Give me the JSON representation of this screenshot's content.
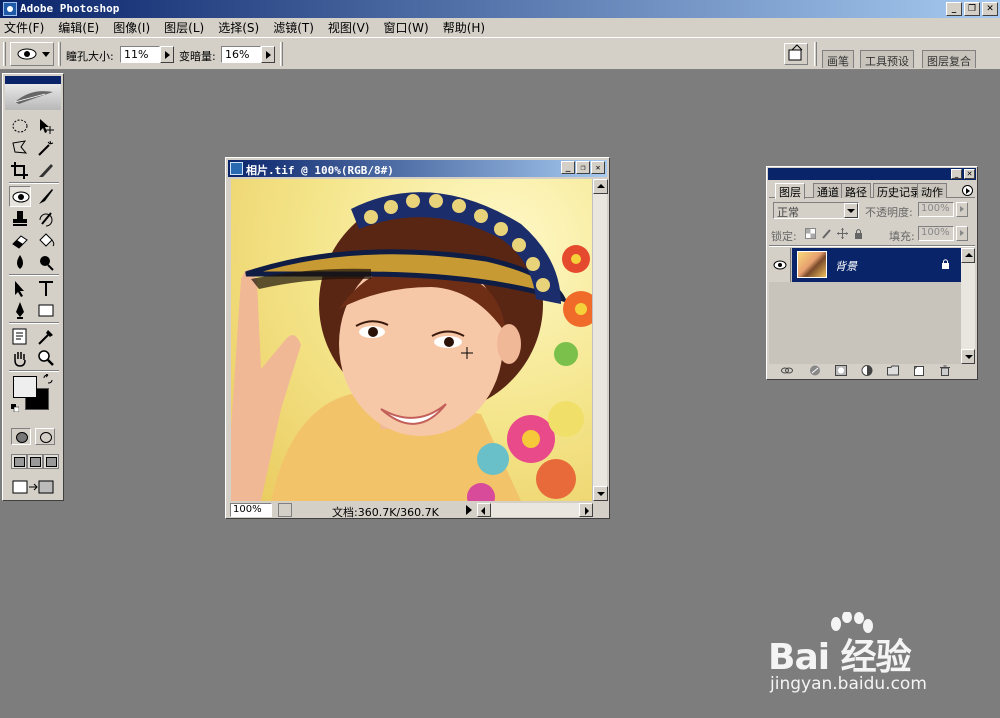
{
  "app": {
    "title": "Adobe Photoshop"
  },
  "window_controls": {
    "minimize": "_",
    "restore": "❐",
    "close": "✕"
  },
  "menu": [
    "文件(F)",
    "编辑(E)",
    "图像(I)",
    "图层(L)",
    "选择(S)",
    "滤镜(T)",
    "视图(V)",
    "窗口(W)",
    "帮助(H)"
  ],
  "options": {
    "pupil_size_label": "瞳孔大小:",
    "pupil_size_value": "11%",
    "darken_label": "变暗量:",
    "darken_value": "16%",
    "palette_well_tabs": [
      "画笔",
      "工具预设",
      "图层复合"
    ]
  },
  "toolbox": {
    "icons": [
      "elliptical-marquee-icon",
      "move-icon",
      "polygonal-lasso-icon",
      "magic-wand-icon",
      "crop-icon",
      "slice-icon",
      "red-eye-icon",
      "brush-icon",
      "clone-stamp-icon",
      "history-brush-icon",
      "eraser-icon",
      "paint-bucket-icon",
      "blur-icon",
      "burn-icon",
      "path-selection-icon",
      "type-icon",
      "pen-icon",
      "rectangle-icon",
      "notes-icon",
      "eyedropper-icon",
      "hand-icon",
      "zoom-icon"
    ],
    "active_tool": "red-eye-icon",
    "foreground_color": "#eeeeee",
    "background_color": "#000000"
  },
  "document": {
    "title": "相片.tif @ 100%(RGB/8#)",
    "zoom": "100%",
    "status": "文档:360.7K/360.7K"
  },
  "layers_panel": {
    "tabs": [
      "图层",
      "通道",
      "路径",
      "历史记录",
      "动作"
    ],
    "blend_mode": "正常",
    "opacity_label": "不透明度:",
    "opacity_value": "100%",
    "lock_label": "锁定:",
    "fill_label": "填充:",
    "fill_value": "100%",
    "layers": [
      {
        "name": "背景",
        "visible": true,
        "locked": true,
        "selected": true
      }
    ]
  },
  "watermark": {
    "brand": "Bai 经验",
    "url": "jingyan.baidu.com"
  },
  "colors": {
    "desktop": "#7d7d7d",
    "chrome": "#d4d0c8",
    "titlebar": "#0a246a",
    "selection": "#0a246a"
  }
}
